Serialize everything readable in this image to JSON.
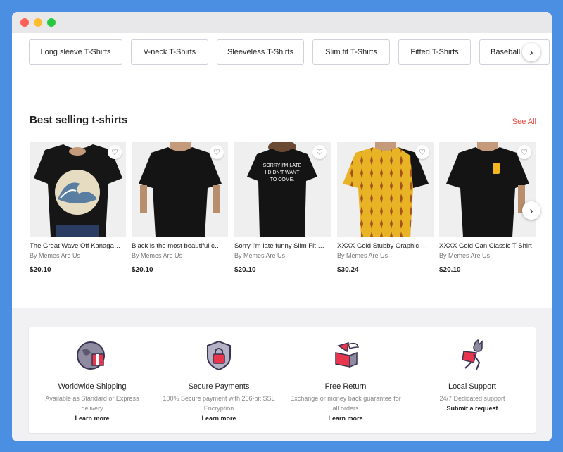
{
  "categories": {
    "chips": [
      "Long sleeve T-Shirts",
      "V-neck T-Shirts",
      "Sleeveless T-Shirts",
      "Slim fit T-Shirts",
      "Fitted T-Shirts",
      "Baseball"
    ],
    "next_icon": "chevron-right-icon"
  },
  "best_selling": {
    "title": "Best selling t-shirts",
    "see_all": "See All",
    "products": [
      {
        "title": "The Great Wave Off Kanagawa…",
        "by": "By Memes Are Us",
        "price": "$20.10",
        "shirt_color": "#111",
        "print": "wave",
        "print_text": ""
      },
      {
        "title": "Black is the most beautiful c…",
        "by": "By Memes Are Us",
        "price": "$20.10",
        "shirt_color": "#111",
        "print": "none",
        "print_text": ""
      },
      {
        "title": "Sorry I'm late funny Slim Fit …",
        "by": "By Memes Are Us",
        "price": "$20.10",
        "shirt_color": "#111",
        "print": "text",
        "print_text": "SORRY I'M LATE I DIDN'T WANT TO COME."
      },
      {
        "title": "XXXX Gold Stubby Graphic T-…",
        "by": "By Memes Are Us",
        "price": "$30.24",
        "shirt_color": "#e8b324",
        "print": "pattern",
        "print_text": ""
      },
      {
        "title": "XXXX Gold Can Classic T-Shirt",
        "by": "By Memes Are Us",
        "price": "$20.10",
        "shirt_color": "#111",
        "print": "can",
        "print_text": ""
      }
    ]
  },
  "features": [
    {
      "name": "Worldwide Shipping",
      "desc": "Available as Standard or Express delivery",
      "link": "Learn more",
      "icon": "globe-gift-icon"
    },
    {
      "name": "Secure Payments",
      "desc": "100% Secure payment with 256-bit SSL Encryption",
      "link": "Learn more",
      "icon": "shield-lock-icon"
    },
    {
      "name": "Free Return",
      "desc": "Exchange or money back guarantee for all orders",
      "link": "Learn more",
      "icon": "winged-box-icon"
    },
    {
      "name": "Local Support",
      "desc": "24/7 Dedicated support",
      "link": "Submit a request",
      "icon": "cat-mascot-icon"
    }
  ]
}
